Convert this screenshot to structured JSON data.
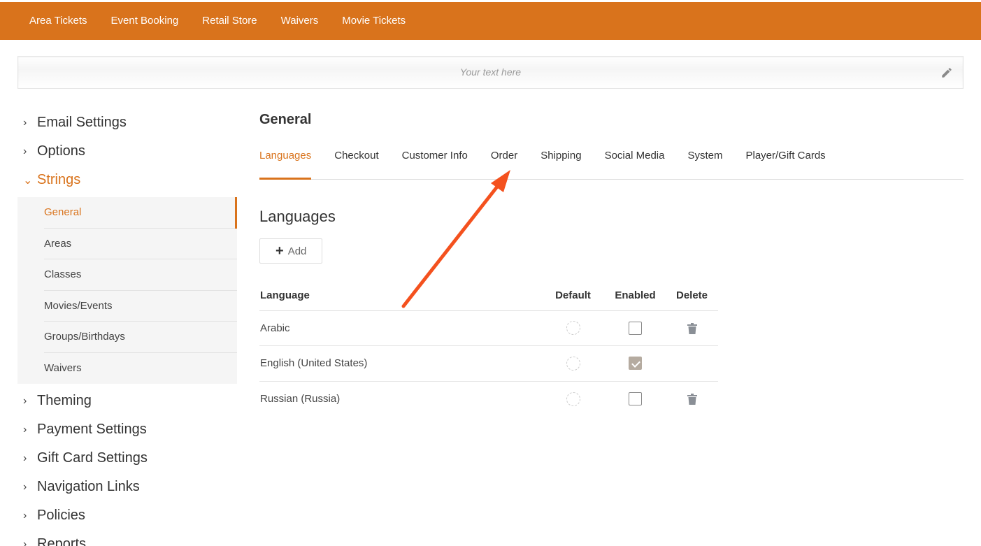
{
  "topnav": {
    "items": [
      "Area Tickets",
      "Event Booking",
      "Retail Store",
      "Waivers",
      "Movie Tickets"
    ],
    "bg_color": "#d9731c"
  },
  "banner": {
    "placeholder": "Your text here",
    "icon": "pencil-icon"
  },
  "sidebar": {
    "items": [
      {
        "label": "Email Settings",
        "expanded": false
      },
      {
        "label": "Options",
        "expanded": false
      },
      {
        "label": "Strings",
        "expanded": true
      },
      {
        "label": "Theming",
        "expanded": false
      },
      {
        "label": "Payment Settings",
        "expanded": false
      },
      {
        "label": "Gift Card Settings",
        "expanded": false
      },
      {
        "label": "Navigation Links",
        "expanded": false
      },
      {
        "label": "Policies",
        "expanded": false
      },
      {
        "label": "Reports",
        "expanded": false
      }
    ],
    "strings_subitems": [
      "General",
      "Areas",
      "Classes",
      "Movies/Events",
      "Groups/Birthdays",
      "Waivers"
    ],
    "active_subitem": "General"
  },
  "main": {
    "title": "General",
    "tabs": [
      "Languages",
      "Checkout",
      "Customer Info",
      "Order",
      "Shipping",
      "Social Media",
      "System",
      "Player/Gift Cards"
    ],
    "active_tab": "Languages",
    "section_title": "Languages",
    "add_label": "Add",
    "table": {
      "headers": {
        "language": "Language",
        "default": "Default",
        "enabled": "Enabled",
        "delete": "Delete"
      },
      "rows": [
        {
          "language": "Arabic",
          "default": false,
          "enabled": false,
          "deletable": true
        },
        {
          "language": "English (United States)",
          "default": false,
          "enabled": true,
          "deletable": false
        },
        {
          "language": "Russian (Russia)",
          "default": false,
          "enabled": false,
          "deletable": true
        }
      ]
    }
  },
  "annotation": {
    "arrow_color": "#f4511e",
    "points_to": "Order"
  },
  "colors": {
    "accent": "#d9731c",
    "checked_bg": "#b5aba0"
  }
}
